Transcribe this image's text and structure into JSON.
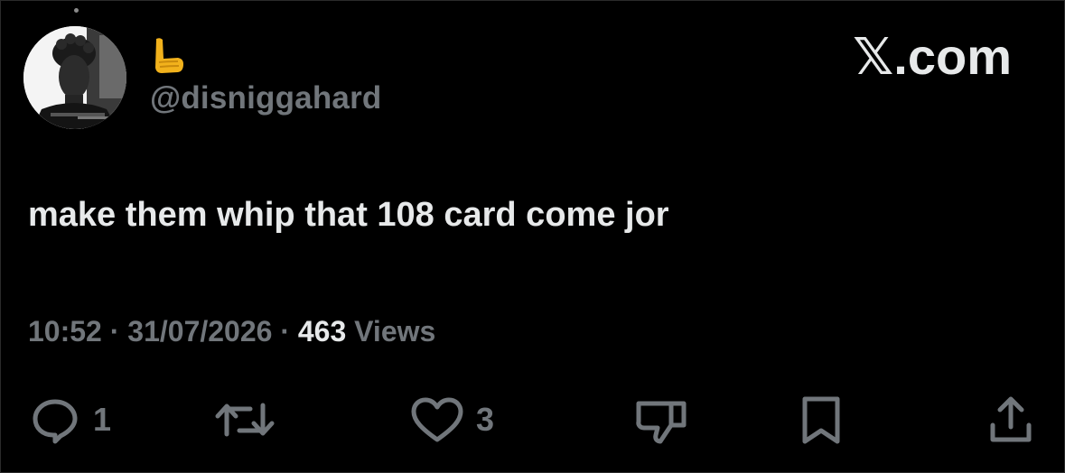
{
  "tweet": {
    "name_emoji": "L-shaped hand emoji",
    "handle": "@disniggahard",
    "brand": "𝕏.com",
    "text": "make them whip that 108 card come jor",
    "time": "10:52",
    "date": "31/07/2026",
    "separator": "·",
    "views_count": "463",
    "views_label": "Views"
  },
  "actions": {
    "reply_count": "1",
    "like_count": "3"
  },
  "colors": {
    "background": "#000000",
    "text_primary": "#e7e9ea",
    "text_secondary": "#71767b",
    "emoji_gold": "#f2b21c"
  },
  "icons": [
    "reply-icon",
    "retweet-icon",
    "like-icon",
    "dislike-icon",
    "bookmark-icon",
    "share-icon"
  ]
}
